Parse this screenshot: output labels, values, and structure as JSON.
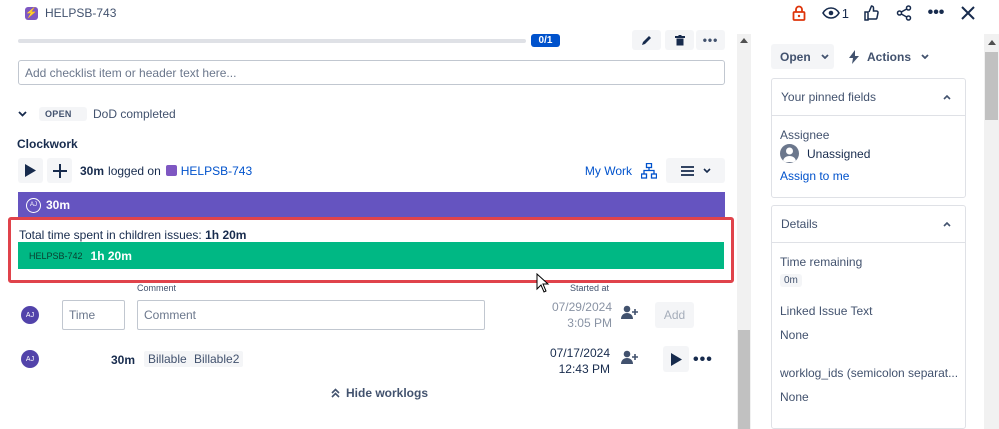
{
  "header": {
    "issue_key": "HELPSB-743",
    "watch_count": "1",
    "icons": [
      "lock-icon",
      "eye-icon",
      "thumbs-up-icon",
      "share-icon",
      "more-icon",
      "close-icon"
    ]
  },
  "checklist": {
    "progress_label": "0/1",
    "progress_fraction": 0,
    "input_placeholder": "Add checklist item or header text here...",
    "item": {
      "status": "OPEN",
      "text": "DoD completed"
    }
  },
  "clockwork": {
    "title": "Clockwork",
    "logged_amount": "30m",
    "logged_on_text": "logged on",
    "logged_issue": "HELPSB-743",
    "my_work_label": "My Work",
    "purple_bar": {
      "initials": "AJ",
      "duration": "30m"
    },
    "children_label": "Total time spent in children issues:",
    "children_total": "1h 20m",
    "child_bar": {
      "key": "HELPSB-742",
      "duration": "1h 20m"
    },
    "columns": {
      "comment": "Comment",
      "started_at": "Started at"
    },
    "new_entry": {
      "initials": "AJ",
      "time_placeholder": "Time",
      "comment_placeholder": "Comment",
      "date": "07/29/2024",
      "time": "3:05 PM",
      "add_label": "Add"
    },
    "worklog": {
      "initials": "AJ",
      "duration": "30m",
      "tags": [
        "Billable",
        "Billable2"
      ],
      "date": "07/17/2024",
      "time": "12:43 PM"
    },
    "hide_worklogs": "Hide worklogs"
  },
  "sidebar": {
    "status_button": "Open",
    "actions_button": "Actions",
    "pinned": {
      "title": "Your pinned fields",
      "assignee_label": "Assignee",
      "assignee_value": "Unassigned",
      "assign_link": "Assign to me"
    },
    "details": {
      "title": "Details",
      "time_remaining_label": "Time remaining",
      "time_remaining_value": "0m",
      "linked_label": "Linked Issue Text",
      "linked_value": "None",
      "worklog_ids_label": "worklog_ids (semicolon separat...",
      "worklog_ids_value": "None"
    }
  },
  "colors": {
    "purple": "#6554c0",
    "green": "#00b884",
    "highlight_red": "#e0434b",
    "link_blue": "#0052cc"
  }
}
